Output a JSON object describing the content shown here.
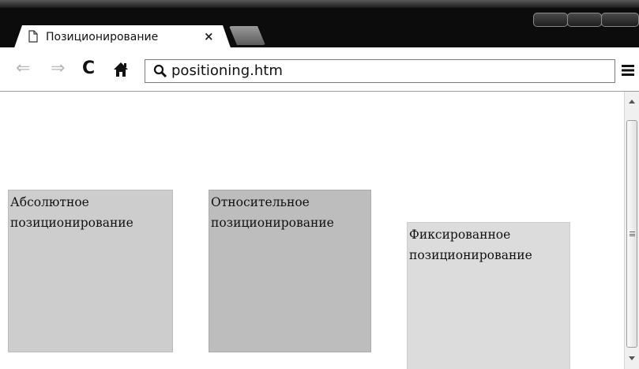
{
  "browser": {
    "tab": {
      "title": "Позиционирование",
      "close_symbol": "×",
      "icon": "page-icon"
    },
    "toolbar": {
      "back_symbol": "⇐",
      "forward_symbol": "⇒",
      "reload_symbol": "C",
      "address": "positioning.htm"
    }
  },
  "page": {
    "boxes": [
      {
        "label": "Абсолютное позиционирование",
        "color": "#cdcdcd"
      },
      {
        "label": "Относительное позиционирование",
        "color": "#bdbdbd"
      },
      {
        "label": "Фиксированное позиционирование",
        "color": "#dcdcdc"
      }
    ]
  }
}
